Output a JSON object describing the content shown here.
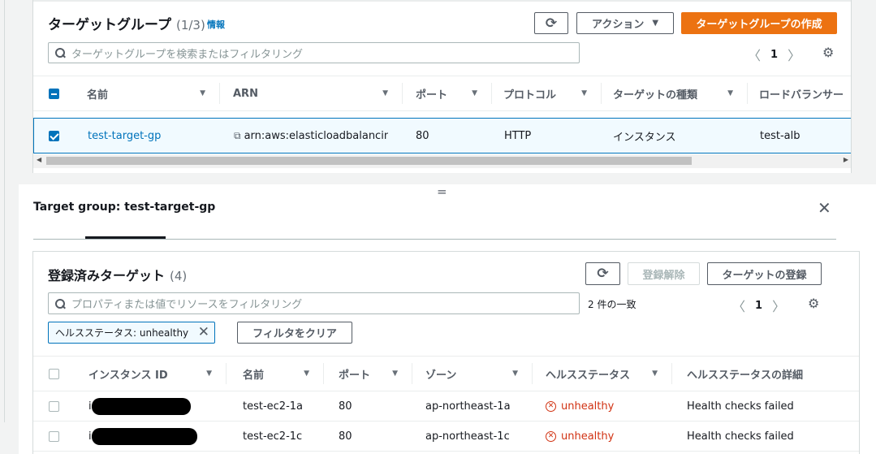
{
  "target_groups": {
    "title": "ターゲットグループ",
    "count": "(1/3)",
    "info": "情報",
    "refresh_icon": "refresh-icon",
    "actions_label": "アクション",
    "create_label": "ターゲットグループの作成",
    "search_placeholder": "ターゲットグループを検索またはフィルタリング",
    "page": "1",
    "columns": [
      "名前",
      "ARN",
      "ポート",
      "プロトコル",
      "ターゲットの種類",
      "ロードバランサー"
    ],
    "row": {
      "name": "test-target-gp",
      "arn": "arn:aws:elasticloadbalancin…",
      "port": "80",
      "protocol": "HTTP",
      "target_type": "インスタンス",
      "load_balancer": "test-alb"
    }
  },
  "detail": {
    "split_handle": "=",
    "title": "Target group: test-target-gp"
  },
  "registered_targets": {
    "title": "登録済みターゲット",
    "count": "(4)",
    "deregister_label": "登録解除",
    "register_label": "ターゲットの登録",
    "search_placeholder": "プロパティまたは値でリソースをフィルタリング",
    "match_count": "2 件の一致",
    "page": "1",
    "filter_token": "ヘルスステータス: unhealthy",
    "clear_filter_label": "フィルタをクリア",
    "columns": [
      "インスタンス ID",
      "名前",
      "ポート",
      "ゾーン",
      "ヘルスステータス",
      "ヘルスステータスの詳細"
    ],
    "rows": [
      {
        "instance_id": "i",
        "name": "test-ec2-1a",
        "port": "80",
        "zone": "ap-northeast-1a",
        "health": "unhealthy",
        "detail": "Health checks failed"
      },
      {
        "instance_id": "i",
        "name": "test-ec2-1c",
        "port": "80",
        "zone": "ap-northeast-1c",
        "health": "unhealthy",
        "detail": "Health checks failed"
      }
    ]
  },
  "colors": {
    "accent": "#ec7211",
    "link": "#0073bb",
    "error": "#d13212"
  }
}
